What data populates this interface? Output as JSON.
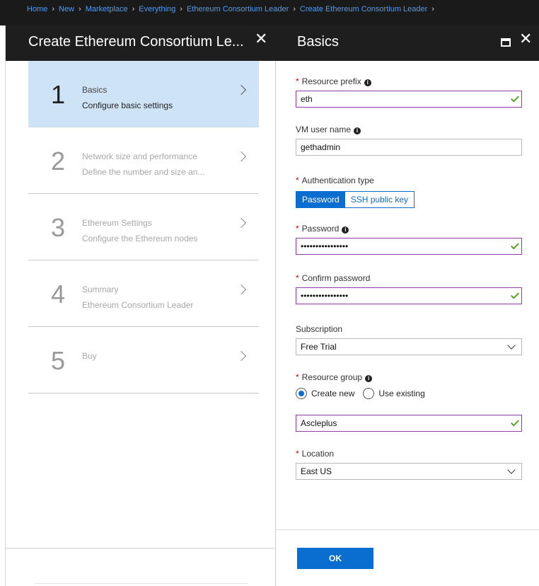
{
  "breadcrumb": [
    "Home",
    "New",
    "Marketplace",
    "Everything",
    "Ethereum Consortium Leader",
    "Create Ethereum Consortium Leader"
  ],
  "left_panel": {
    "title": "Create Ethereum Consortium Le...",
    "close_glyph": "✕",
    "steps": [
      {
        "number": "1",
        "title": "Basics",
        "subtitle": "Configure basic settings",
        "active": true
      },
      {
        "number": "2",
        "title": "Network size and performance",
        "subtitle": "Define the number and size an...",
        "active": false
      },
      {
        "number": "3",
        "title": "Ethereum Settings",
        "subtitle": "Configure the Ethereum nodes",
        "active": false
      },
      {
        "number": "4",
        "title": "Summary",
        "subtitle": "Ethereum Consortium Leader",
        "active": false
      },
      {
        "number": "5",
        "title": "Buy",
        "subtitle": "",
        "active": false
      }
    ]
  },
  "right_panel": {
    "title": "Basics",
    "close_glyph": "✕",
    "fields": {
      "resource_prefix": {
        "label": "Resource prefix",
        "value": "eth",
        "required": true
      },
      "vm_user_name": {
        "label": "VM user name",
        "value": "gethadmin"
      },
      "auth_type": {
        "label": "Authentication type",
        "options": [
          "Password",
          "SSH public key"
        ],
        "selected": "Password",
        "required": true
      },
      "password": {
        "label": "Password",
        "value": "••••••••••••••••",
        "required": true
      },
      "confirm_password": {
        "label": "Confirm password",
        "value": "••••••••••••••••",
        "required": true
      },
      "subscription": {
        "label": "Subscription",
        "value": "Free Trial"
      },
      "resource_group": {
        "label": "Resource group",
        "options": [
          "Create new",
          "Use existing"
        ],
        "selected": "Create new",
        "value": "Ascleplus",
        "required": true
      },
      "location": {
        "label": "Location",
        "value": "East US",
        "required": true
      }
    },
    "ok_label": "OK"
  },
  "icons": {
    "info": "info-icon",
    "check": "checkmark-icon",
    "chevron": "chevron-right-icon",
    "dropdown": "chevron-down-icon",
    "maximize": "maximize-icon",
    "close": "close-icon"
  },
  "colors": {
    "accent": "#0a6ed1",
    "active_step": "#cfe3f7",
    "valid_border": "#8c3ca5",
    "required": "#e00000",
    "header": "#1e1e1e"
  }
}
